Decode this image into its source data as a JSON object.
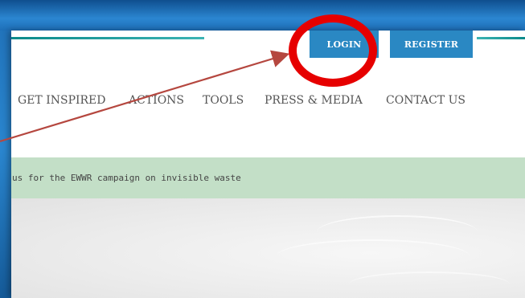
{
  "header": {
    "login_label": "LOGIN",
    "register_label": "REGISTER"
  },
  "nav": {
    "items": [
      {
        "label": "GET INSPIRED"
      },
      {
        "label": "ACTIONS"
      },
      {
        "label": "TOOLS"
      },
      {
        "label": "PRESS & MEDIA"
      },
      {
        "label": "CONTACT US"
      }
    ]
  },
  "banner": {
    "text": "us for the EWWR campaign on invisible waste"
  },
  "colors": {
    "button_bg": "#2a88c3",
    "annotation_red": "#e60000",
    "arrow_color": "#b5473f",
    "banner_bg": "#c3dfc7",
    "outer_bg": "#2a86cf"
  },
  "annotation": {
    "highlight_target": "login-button"
  }
}
